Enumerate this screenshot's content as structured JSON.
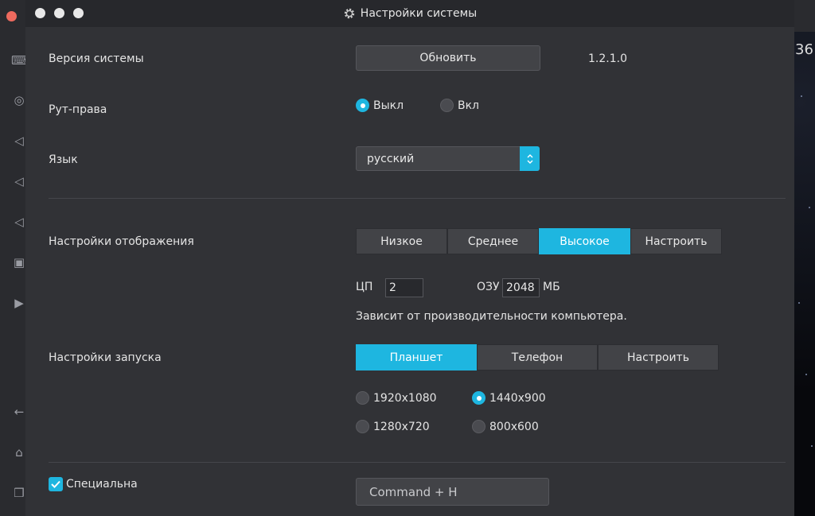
{
  "window": {
    "title": "Настройки системы"
  },
  "background": {
    "corner_text": "36"
  },
  "system_version": {
    "label": "Версия системы",
    "update_button": "Обновить",
    "value": "1.2.1.0"
  },
  "root": {
    "label": "Рут-права",
    "options": [
      {
        "label": "Выкл",
        "selected": true
      },
      {
        "label": "Вкл",
        "selected": false
      }
    ]
  },
  "language": {
    "label": "Язык",
    "value": "русский"
  },
  "display": {
    "label": "Настройки отображения",
    "options": [
      {
        "label": "Низкое",
        "selected": false
      },
      {
        "label": "Среднее",
        "selected": false
      },
      {
        "label": "Высокое",
        "selected": true
      },
      {
        "label": "Настроить",
        "selected": false
      }
    ],
    "cpu_label": "ЦП",
    "cpu_value": "2",
    "ram_label": "ОЗУ",
    "ram_value": "2048",
    "ram_unit": "МБ",
    "hint": "Зависит от производительности компьютера."
  },
  "launch": {
    "label": "Настройки запуска",
    "options": [
      {
        "label": "Планшет",
        "selected": true
      },
      {
        "label": "Телефон",
        "selected": false
      },
      {
        "label": "Настроить",
        "selected": false
      }
    ],
    "resolutions": [
      {
        "label": "1920x1080",
        "selected": false
      },
      {
        "label": "1440x900",
        "selected": true
      },
      {
        "label": "1280x720",
        "selected": false
      },
      {
        "label": "800x600",
        "selected": false
      }
    ]
  },
  "special": {
    "label": "Специальна",
    "checked": true,
    "hotkey": "Command + H"
  },
  "colors": {
    "accent": "#1eb6e0",
    "dialog_bg": "#313236",
    "control_bg": "#424347"
  }
}
